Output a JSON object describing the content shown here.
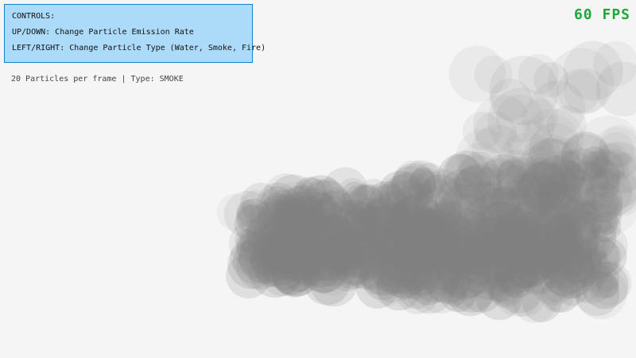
{
  "controls": {
    "title": "CONTROLS:",
    "line_rate": "UP/DOWN: Change Particle Emission Rate",
    "line_type": "LEFT/RIGHT: Change Particle Type (Water, Smoke, Fire)"
  },
  "status": {
    "text": "20 Particles per frame | Type: SMOKE"
  },
  "fps": {
    "text": "60 FPS"
  },
  "particle_type": "SMOKE",
  "colors": {
    "background": "#f5f5f5",
    "panel_fill": "#acdbf9",
    "panel_border": "#0e87c8",
    "fps_text": "#1fa83a",
    "smoke": "#808080"
  }
}
